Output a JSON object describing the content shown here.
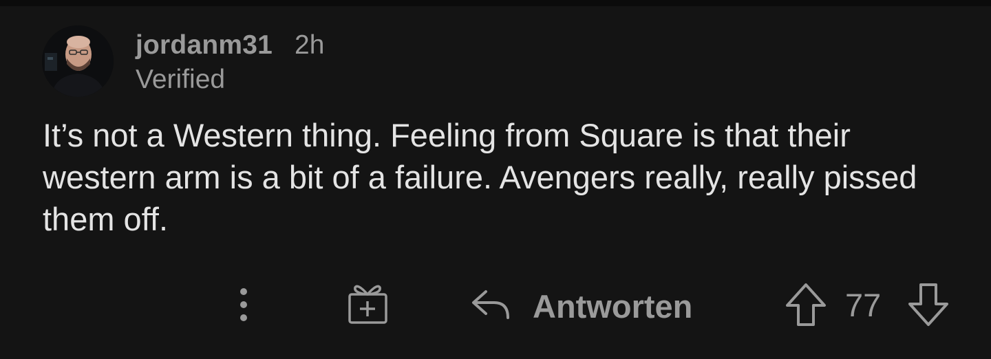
{
  "comment": {
    "author": "jordanm31",
    "timestamp": "2h",
    "flair": "Verified",
    "body": "It’s not a Western thing. Feeling from Square is that their western arm is a bit of a failure. Avengers really, really pissed them off."
  },
  "actions": {
    "more_icon": "vertical-dots-icon",
    "award_icon": "gift-icon",
    "reply_icon": "reply-arrow-icon",
    "reply_label": "Antworten",
    "upvote_icon": "arrow-up-icon",
    "vote_count": "77",
    "downvote_icon": "arrow-down-icon"
  },
  "colors": {
    "background": "#141414",
    "text_primary": "#e4e4e4",
    "text_secondary": "#9a9a9a"
  }
}
